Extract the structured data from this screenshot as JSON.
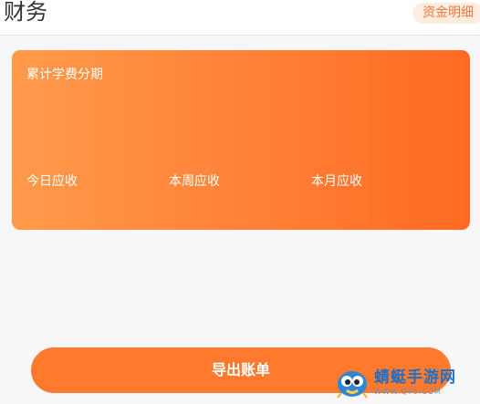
{
  "header": {
    "title": "财务",
    "detail_button": "资金明细"
  },
  "summary": {
    "card_label": "累计学费分期",
    "today_label": "今日应收",
    "week_label": "本周应收",
    "month_label": "本月应收"
  },
  "actions": {
    "export_label": "导出账单"
  },
  "watermark": {
    "name": "蜻蜓手游网",
    "url": "WWW.QT6.COM"
  },
  "colors": {
    "accent": "#ff7a2c",
    "card_gradient_start": "#ff9a4a",
    "card_gradient_end": "#ff6a22",
    "detail_button_bg": "#fdece0",
    "watermark_text": "#1e6fc7"
  }
}
